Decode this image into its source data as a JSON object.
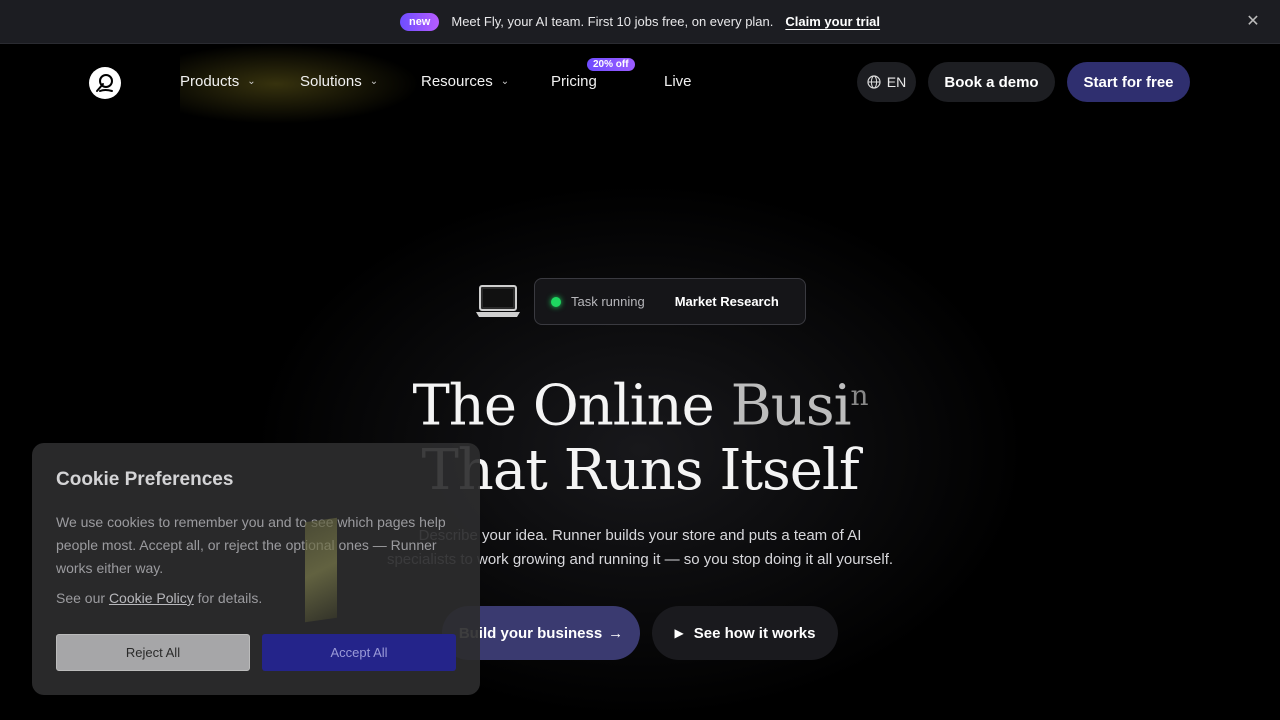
{
  "announcement": {
    "badge": "new",
    "text": "Meet Fly, your AI team. First 10 jobs free, on every plan.",
    "link": "Claim your trial"
  },
  "nav": {
    "items": [
      {
        "label": "Products"
      },
      {
        "label": "Solutions"
      },
      {
        "label": "Resources"
      },
      {
        "label": "Pricing"
      },
      {
        "label": "Live"
      }
    ],
    "pricing_badge": "20% off",
    "lang": "EN",
    "demo": "Book a demo",
    "start": "Start for free"
  },
  "hero": {
    "task_status": "Task running",
    "task_name": "Market Research",
    "headline_line1_a": "The Online ",
    "headline_line1_b": "Busi",
    "headline_line1_c": "n",
    "headline_line2": "That Runs Itself",
    "subtext_line1": "Describe your idea. Runner builds your store and puts a team of AI",
    "subtext_line2": "specialists to work growing and running it — so you stop doing it all yourself.",
    "cta_primary": "Build your business",
    "cta_secondary": "See how it works"
  },
  "cookie": {
    "title": "Cookie Preferences",
    "body": "We use cookies to remember you and to see which pages help people most. Accept all, or reject the optional ones — Runner works either way.",
    "policy_prefix": "See our ",
    "policy_link": "Cookie Policy",
    "policy_suffix": " for details.",
    "reject": "Reject All",
    "accept": "Accept All"
  }
}
